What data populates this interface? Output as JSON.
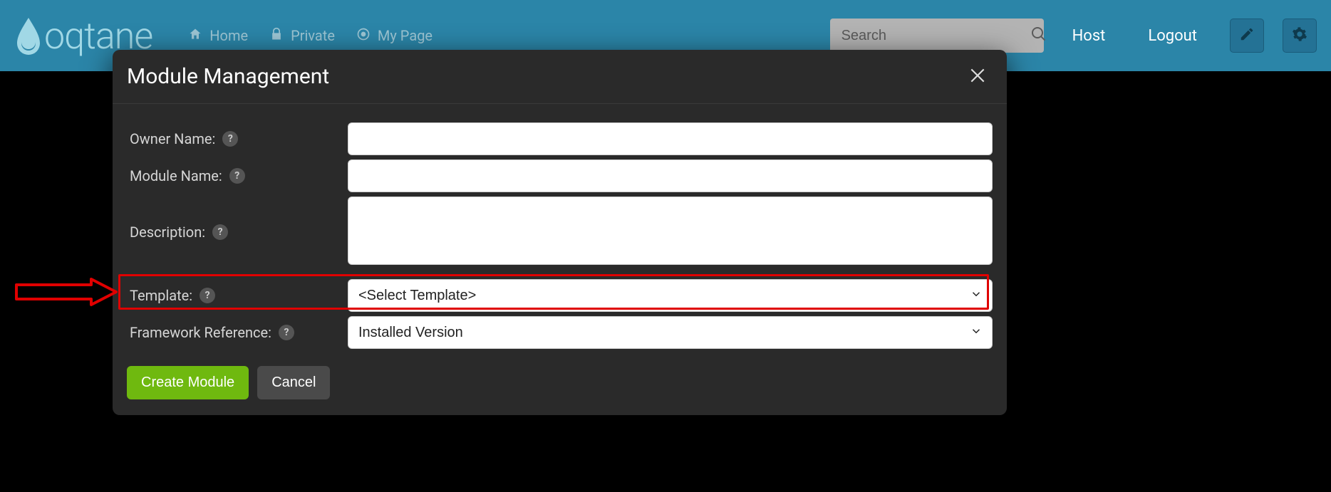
{
  "brand": {
    "name": "oqtane"
  },
  "nav": {
    "items": [
      {
        "label": "Home",
        "icon": "home-icon"
      },
      {
        "label": "Private",
        "icon": "lock-icon"
      },
      {
        "label": "My Page",
        "icon": "target-icon"
      }
    ]
  },
  "search": {
    "placeholder": "Search"
  },
  "toplinks": {
    "host": "Host",
    "logout": "Logout"
  },
  "modal": {
    "title": "Module Management",
    "fields": {
      "owner_label": "Owner Name:",
      "owner_value": "",
      "module_label": "Module Name:",
      "module_value": "",
      "description_label": "Description:",
      "description_value": "",
      "template_label": "Template:",
      "template_selected": "<Select Template>",
      "framework_label": "Framework Reference:",
      "framework_selected": "Installed Version"
    },
    "buttons": {
      "create": "Create Module",
      "cancel": "Cancel"
    }
  },
  "colors": {
    "topbar": "#2b85a8",
    "accent": "#6fb90f",
    "highlight": "#e00000"
  }
}
